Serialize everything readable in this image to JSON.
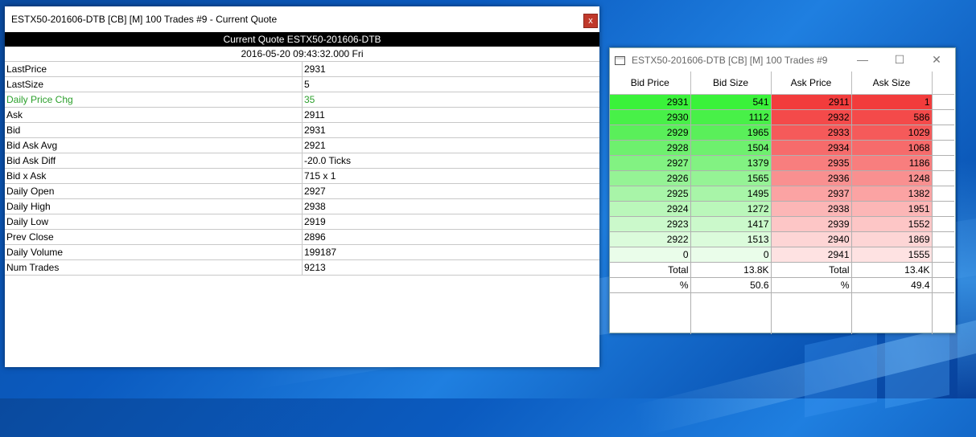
{
  "quote_window": {
    "title": "ESTX50-201606-DTB [CB] [M]  100 Trades  #9 - Current Quote",
    "close_label": "x",
    "header": "Current Quote  ESTX50-201606-DTB",
    "datetime": "2016-05-20  09:43:32.000 Fri",
    "rows": [
      {
        "label": "LastPrice",
        "value": "2931"
      },
      {
        "label": "LastSize",
        "value": "5"
      },
      {
        "label": "Daily Price Chg",
        "value": "35"
      },
      {
        "label": "Ask",
        "value": "2911"
      },
      {
        "label": "Bid",
        "value": "2931"
      },
      {
        "label": "Bid Ask Avg",
        "value": "2921"
      },
      {
        "label": "Bid Ask Diff",
        "value": "-20.0 Ticks"
      },
      {
        "label": "Bid x Ask",
        "value": "715 x 1"
      },
      {
        "label": "Daily Open",
        "value": "2927"
      },
      {
        "label": "Daily High",
        "value": "2938"
      },
      {
        "label": "Daily Low",
        "value": "2919"
      },
      {
        "label": "Prev Close",
        "value": "2896"
      },
      {
        "label": "Daily Volume",
        "value": "199187"
      },
      {
        "label": "Num Trades",
        "value": "9213"
      }
    ],
    "highlight_color": "#2ca02c"
  },
  "depth_window": {
    "title": "ESTX50-201606-DTB [CB] [M]  100 Trades  #9",
    "minimize_glyph": "—",
    "maximize_glyph": "☐",
    "close_glyph": "✕",
    "columns": [
      "Bid Price",
      "Bid Size",
      "Ask Price",
      "Ask Size"
    ],
    "rows": [
      {
        "bid_price": "2931",
        "bid_size": "541",
        "ask_price": "2911",
        "ask_size": "1",
        "bid_color": "#3af23a",
        "ask_color": "#f23c3c"
      },
      {
        "bid_price": "2930",
        "bid_size": "1112",
        "ask_price": "2932",
        "ask_size": "586",
        "bid_color": "#48f048",
        "ask_color": "#f44a4a"
      },
      {
        "bid_price": "2929",
        "bid_size": "1965",
        "ask_price": "2933",
        "ask_size": "1029",
        "bid_color": "#5aef5a",
        "ask_color": "#f55a5a"
      },
      {
        "bid_price": "2928",
        "bid_size": "1504",
        "ask_price": "2934",
        "ask_size": "1068",
        "bid_color": "#6ef06e",
        "ask_color": "#f66b6b"
      },
      {
        "bid_price": "2927",
        "bid_size": "1379",
        "ask_price": "2935",
        "ask_size": "1186",
        "bid_color": "#82f282",
        "ask_color": "#f87e7e"
      },
      {
        "bid_price": "2926",
        "bid_size": "1565",
        "ask_price": "2936",
        "ask_size": "1248",
        "bid_color": "#95f395",
        "ask_color": "#f99090"
      },
      {
        "bid_price": "2925",
        "bid_size": "1495",
        "ask_price": "2937",
        "ask_size": "1382",
        "bid_color": "#a8f5a8",
        "ask_color": "#fba3a3"
      },
      {
        "bid_price": "2924",
        "bid_size": "1272",
        "ask_price": "2938",
        "ask_size": "1951",
        "bid_color": "#baf7ba",
        "ask_color": "#fcb6b6"
      },
      {
        "bid_price": "2923",
        "bid_size": "1417",
        "ask_price": "2939",
        "ask_size": "1552",
        "bid_color": "#cbf9cb",
        "ask_color": "#fdc6c6"
      },
      {
        "bid_price": "2922",
        "bid_size": "1513",
        "ask_price": "2940",
        "ask_size": "1869",
        "bid_color": "#dbfbdb",
        "ask_color": "#fdd5d5"
      },
      {
        "bid_price": "0",
        "bid_size": "0",
        "ask_price": "2941",
        "ask_size": "1555",
        "bid_color": "#eafdea",
        "ask_color": "#fee2e2"
      },
      {
        "bid_price": "Total",
        "bid_size": "13.8K",
        "ask_price": "Total",
        "ask_size": "13.4K",
        "bid_color": "#ffffff",
        "ask_color": "#ffffff"
      },
      {
        "bid_price": "%",
        "bid_size": "50.6",
        "ask_price": "%",
        "ask_size": "49.4",
        "bid_color": "#ffffff",
        "ask_color": "#ffffff"
      }
    ]
  }
}
